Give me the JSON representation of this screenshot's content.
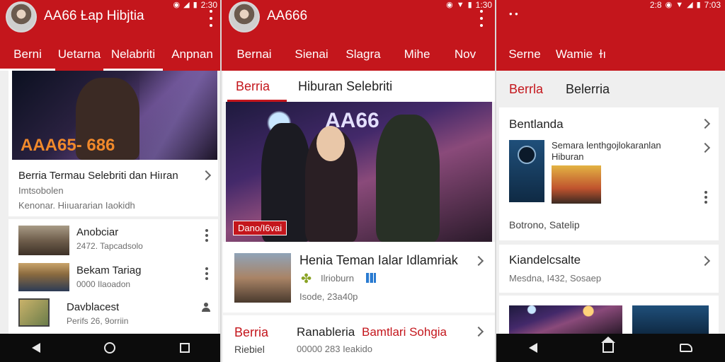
{
  "colors": {
    "brand_red": "#c4161c",
    "nav_black": "#0c0c0c"
  },
  "panel1": {
    "app_title": "AA66 Ƚap Hibjtia",
    "status_time": "2:30",
    "tabs": [
      "Berni",
      "Uetarna",
      "Nelabriti",
      "Anpnan"
    ],
    "hero_text": "AAA65- 686",
    "featured": {
      "title": "Berria Termau Selebriti dan Hiıran",
      "sub1": "Imtsobolen",
      "sub2": "Kenonar. Hiıuararian Iaokidh"
    },
    "list": [
      {
        "title": "Anobciar",
        "meta": "2472. Tapcadsolo"
      },
      {
        "title": "Bekam Tariaɡ",
        "meta": "0000 Ilaoadon"
      },
      {
        "title": "Davblacest",
        "meta": "Perifs 26, 9orriin"
      }
    ]
  },
  "panel2": {
    "app_title": "AA666",
    "status_time": "1:30",
    "tabs": [
      "Bernai",
      "Sienai",
      "Slagra",
      "Mihe",
      "Nov"
    ],
    "sub_tabs": [
      "Berria",
      "Hiburan Selebriti"
    ],
    "hero_text": "AA66",
    "hero_badge": "Dano/I6vai",
    "article1": {
      "title": "Henia Teman Ialar Idlamriak",
      "source": "Ilrioburn",
      "meta": "Isode, 23a40p"
    },
    "article2": {
      "title_a": "Berria",
      "title_b": "Ranableria",
      "title_c": "Bamtlari Sohgia",
      "sub_a": "Riebiel",
      "meta": "00000 283 Ieakido"
    }
  },
  "panel3": {
    "status_time": "7:03",
    "status_left": "2:8",
    "tabs": [
      "Serne",
      "Wamie",
      "ɫı"
    ],
    "sub_tabs": [
      "Berrla",
      "Belerria"
    ],
    "card1": {
      "title": "Bentlanda",
      "item_title": "Semara lenthgojlokaranlan",
      "item_sub": "Hiburan",
      "meta": "Botrono, Satelip"
    },
    "card2": {
      "title": "Kiandelcsalte",
      "meta": "Mesdna, I432, Sosaep"
    }
  }
}
